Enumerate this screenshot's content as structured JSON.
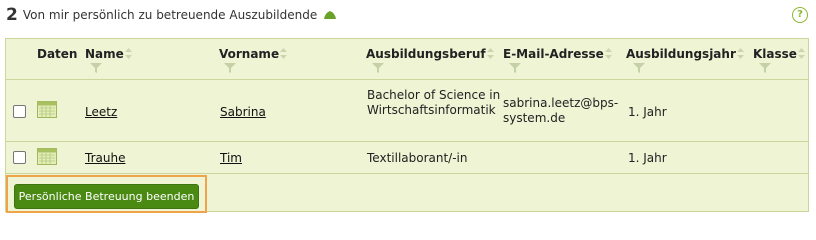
{
  "header": {
    "count": "2",
    "title": "Von mir persönlich zu betreuende Auszubildende"
  },
  "columns": {
    "daten": "Daten",
    "name": "Name",
    "vorname": "Vorname",
    "beruf": "Ausbildungsberuf",
    "email": "E-Mail-Adresse",
    "jahr": "Ausbildungsjahr",
    "klasse": "Klasse"
  },
  "rows": [
    {
      "name": "Leetz",
      "vorname": "Sabrina",
      "beruf": "Bachelor of Science in Wirtschaftsinformatik",
      "email": "sabrina.leetz@bps-system.de",
      "jahr": "1. Jahr",
      "klasse": ""
    },
    {
      "name": "Trauhe",
      "vorname": "Tim",
      "beruf": "Textillaborant/-in",
      "email": "",
      "jahr": "1. Jahr",
      "klasse": ""
    }
  ],
  "actions": {
    "end_button": "Persönliche Betreuung beenden"
  },
  "colors": {
    "accent": "#4a8a13",
    "panel_bg": "#eef4d4",
    "highlight": "#f0a44a"
  }
}
